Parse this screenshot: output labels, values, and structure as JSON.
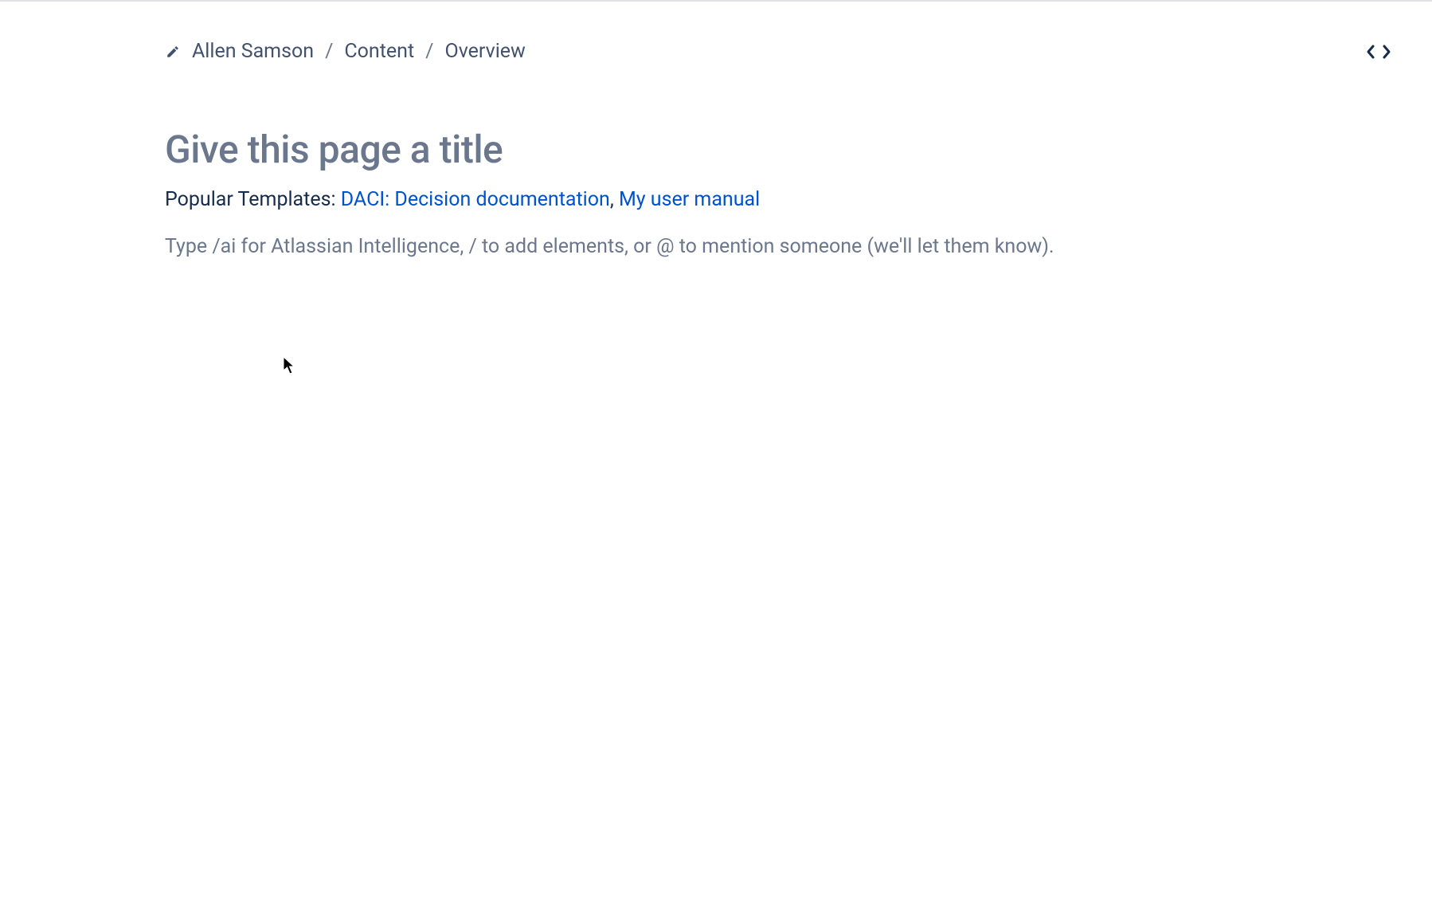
{
  "breadcrumb": {
    "items": [
      "Allen Samson",
      "Content",
      "Overview"
    ],
    "separator": "/"
  },
  "title": {
    "placeholder": "Give this page a title"
  },
  "templates": {
    "label": "Popular Templates: ",
    "items": [
      {
        "name": "DACI: Decision documentation"
      },
      {
        "name": "My user manual"
      }
    ],
    "separator": ", "
  },
  "body": {
    "placeholder": "Type /ai for Atlassian Intelligence, / to add elements, or @ to mention someone (we'll let them know)."
  }
}
